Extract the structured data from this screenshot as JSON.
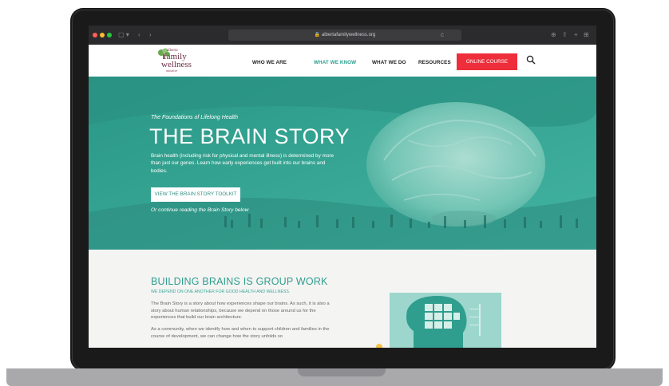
{
  "browser": {
    "url": "albertafamilywellness.org"
  },
  "header": {
    "logo": {
      "line1": "alberta",
      "line2": "family",
      "line3": "wellness",
      "line4": "initiative"
    },
    "nav": [
      {
        "label": "WHO WE ARE",
        "active": false
      },
      {
        "label": "WHAT WE KNOW",
        "active": true
      },
      {
        "label": "WHAT WE DO",
        "active": false
      },
      {
        "label": "RESOURCES",
        "active": false
      }
    ],
    "cta_label": "ONLINE COURSE"
  },
  "hero": {
    "eyebrow": "The Foundations of Lifelong Health",
    "title": "THE BRAIN STORY",
    "body": "Brain health (including risk for physical and mental illness) is determined by more than just our genes. Learn how early experiences get built into our brains and bodies.",
    "button_label": "VIEW THE BRAIN STORY TOOLKIT",
    "note": "Or continue reading the Brain Story below"
  },
  "section": {
    "title": "BUILDING BRAINS IS GROUP WORK",
    "subtitle": "WE DEPEND ON ONE ANOTHER FOR GOOD HEALTH AND WELLNESS.",
    "paragraph1": "The Brain Story is a story about how experiences shape our brains. As such, it is also a story about human relationships, because we depend on those around us for the experiences that build our brain architecture.",
    "paragraph2": "As a community, when we identify how and when to support children and families in the course of development, we can change how the story unfolds so"
  },
  "colors": {
    "accent_teal": "#2f9e8e",
    "cta_red": "#ee2e3a",
    "nav_active": "#2aa08f"
  }
}
